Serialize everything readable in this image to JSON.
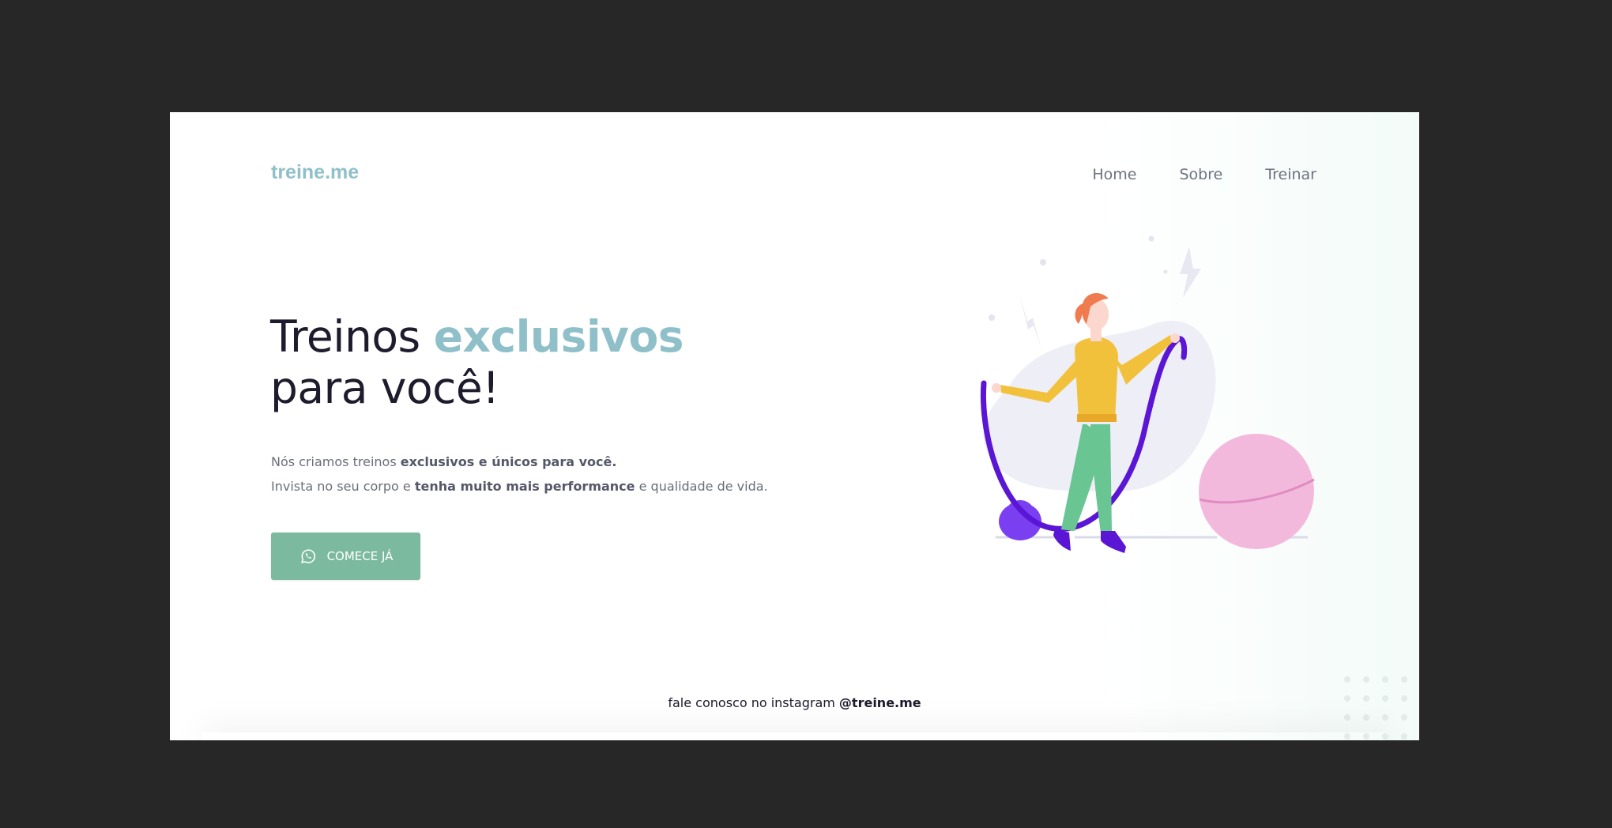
{
  "brand": {
    "logo": "treine.me",
    "accent_color": "#8fc0c9",
    "cta_color": "#7cba9f"
  },
  "nav": {
    "items": [
      {
        "label": "Home"
      },
      {
        "label": "Sobre"
      },
      {
        "label": "Treinar"
      }
    ]
  },
  "hero": {
    "headline_part1": "Treinos ",
    "headline_accent": "exclusivos",
    "headline_part2": "para você!",
    "line1_text": "Nós criamos treinos ",
    "line1_bold": "exclusivos e únicos para você.",
    "line2_text_a": "Invista no seu corpo e ",
    "line2_bold": "tenha muito mais performance",
    "line2_text_b": " e qualidade de vida.",
    "cta_label": "COMECE JÁ",
    "cta_icon": "whatsapp-icon"
  },
  "footer": {
    "text": "fale conosco no instagram ",
    "handle": "@treine.me"
  }
}
